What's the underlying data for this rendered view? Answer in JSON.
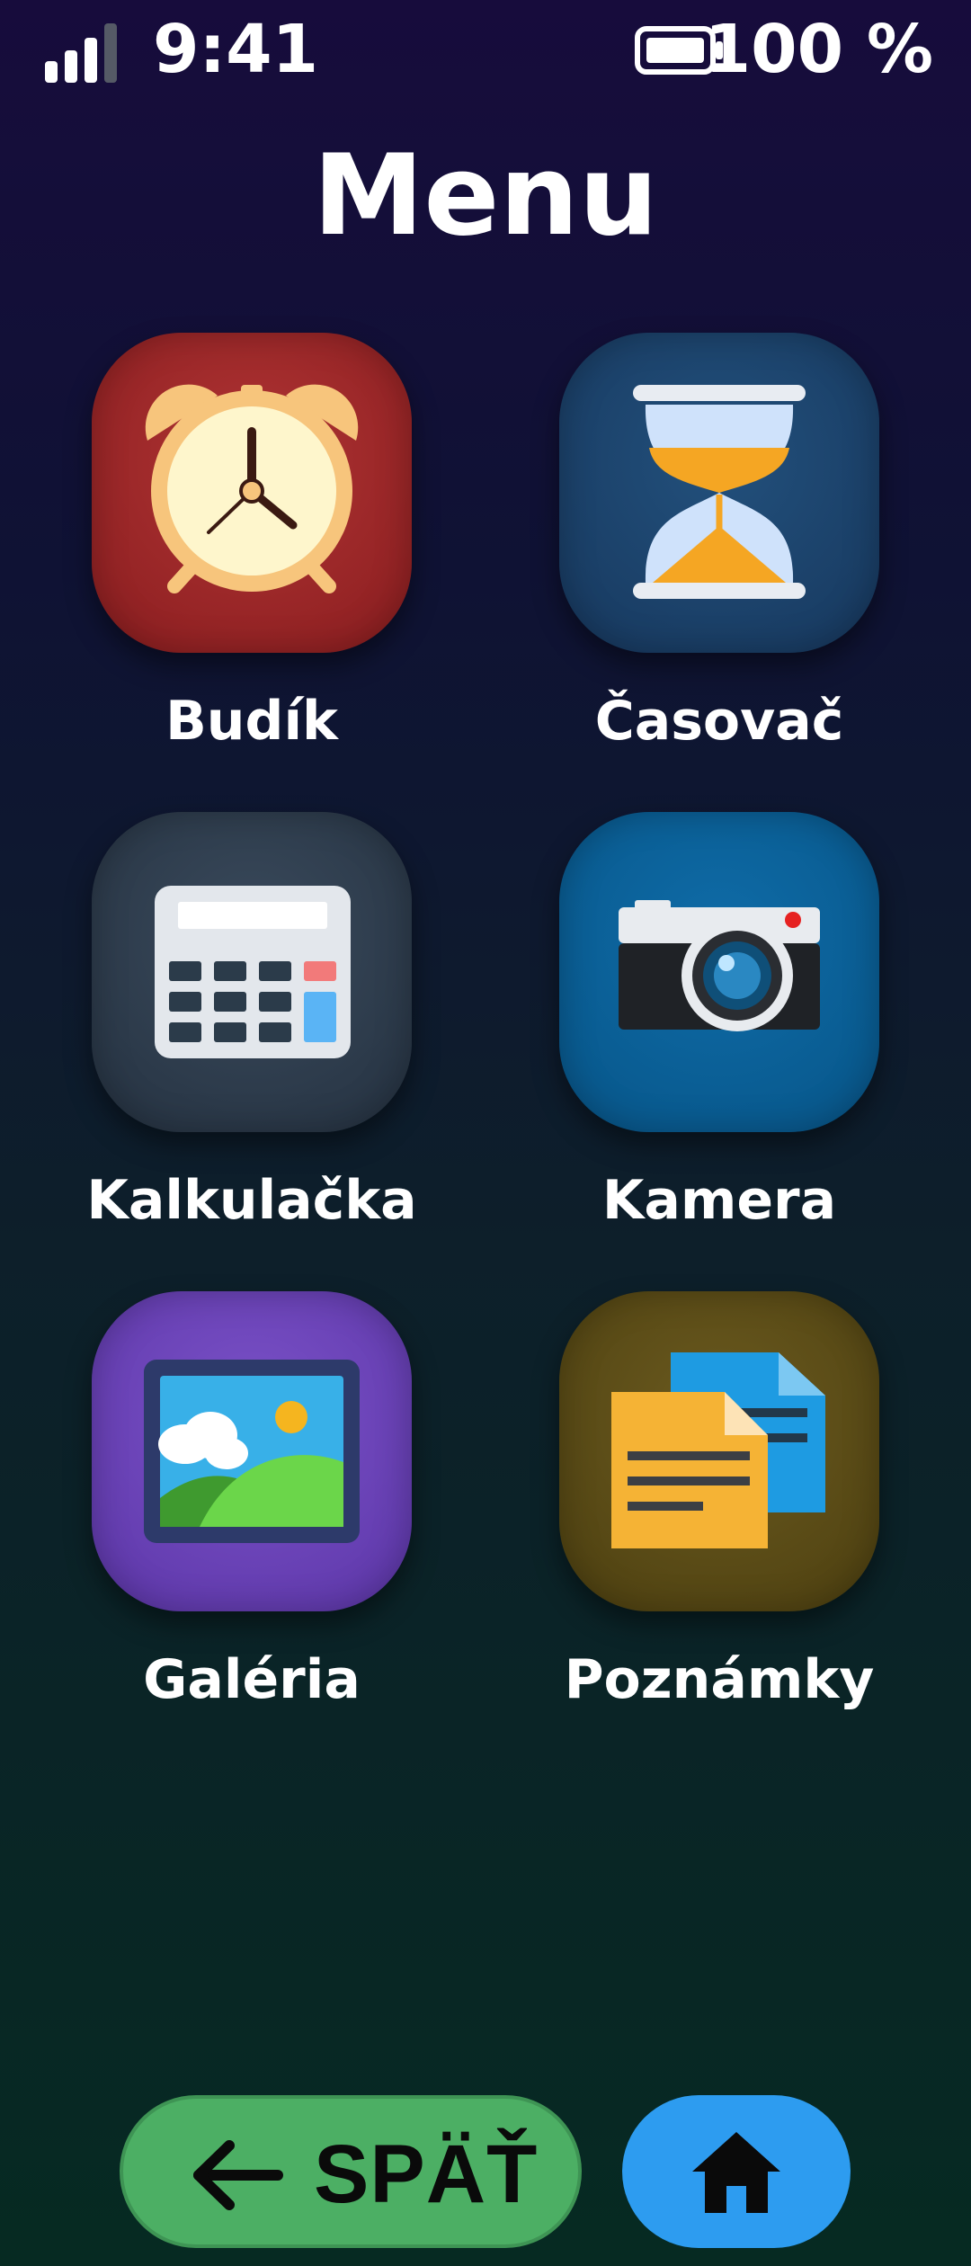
{
  "status_bar": {
    "time": "9:41",
    "battery_percent": "100 %",
    "signal_bars_active": 3,
    "signal_bars_total": 4,
    "battery_level": 1.0
  },
  "header": {
    "title": "Menu"
  },
  "apps": [
    {
      "label": "Budík",
      "icon": "alarm-clock-icon",
      "color": "#9a2526"
    },
    {
      "label": "Časovač",
      "icon": "hourglass-icon",
      "color": "#1d4570"
    },
    {
      "label": "Kalkulačka",
      "icon": "calculator-icon",
      "color": "#2e3c4d"
    },
    {
      "label": "Kamera",
      "icon": "camera-icon",
      "color": "#0b6299"
    },
    {
      "label": "Galéria",
      "icon": "picture-icon",
      "color": "#6a44b8"
    },
    {
      "label": "Poznámky",
      "icon": "notes-icon",
      "color": "#5a4c17"
    }
  ],
  "bottom_nav": {
    "back_label": "SPÄŤ",
    "back_icon": "arrow-left-icon",
    "home_icon": "home-icon",
    "back_color": "#4caf64",
    "home_color": "#2d9cf0"
  }
}
